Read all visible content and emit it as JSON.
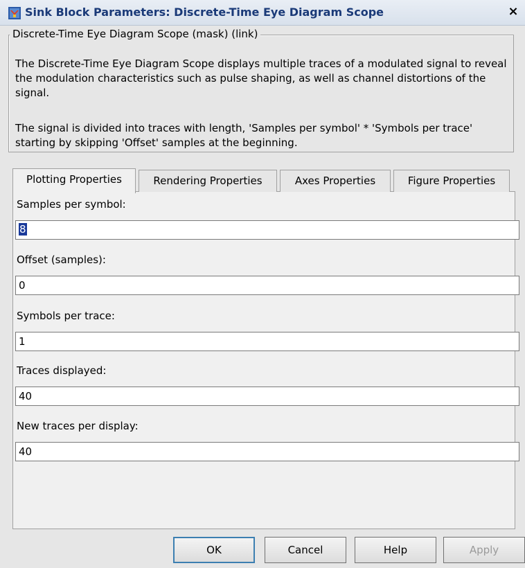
{
  "window": {
    "title": "Sink Block Parameters: Discrete-Time Eye Diagram Scope",
    "close_glyph": "×"
  },
  "description": {
    "legend": "Discrete-Time Eye Diagram Scope (mask) (link)",
    "paragraph1": "The Discrete-Time Eye Diagram Scope displays multiple traces of a modulated signal to reveal the modulation characteristics such as pulse shaping, as well as channel distortions of the signal.",
    "paragraph2": "The signal is divided into traces with length, 'Samples per symbol'  * 'Symbols per trace' starting by skipping 'Offset' samples at the beginning."
  },
  "tabs": [
    {
      "label": "Plotting Properties",
      "active": true
    },
    {
      "label": "Rendering Properties",
      "active": false
    },
    {
      "label": "Axes Properties",
      "active": false
    },
    {
      "label": "Figure Properties",
      "active": false
    }
  ],
  "fields": {
    "samples_per_symbol": {
      "label": "Samples per symbol:",
      "value": "8"
    },
    "offset": {
      "label": "Offset (samples):",
      "value": "0"
    },
    "symbols_per_trace": {
      "label": "Symbols per trace:",
      "value": "1"
    },
    "traces_displayed": {
      "label": "Traces displayed:",
      "value": "40"
    },
    "new_traces": {
      "label": "New traces per display:",
      "value": "40"
    }
  },
  "buttons": {
    "ok": "OK",
    "cancel": "Cancel",
    "help": "Help",
    "apply": "Apply"
  },
  "icons": {
    "app": "simulink-block-icon",
    "close": "close-icon"
  },
  "colors": {
    "title_text": "#1a3a78",
    "selection": "#1a3a9a"
  }
}
